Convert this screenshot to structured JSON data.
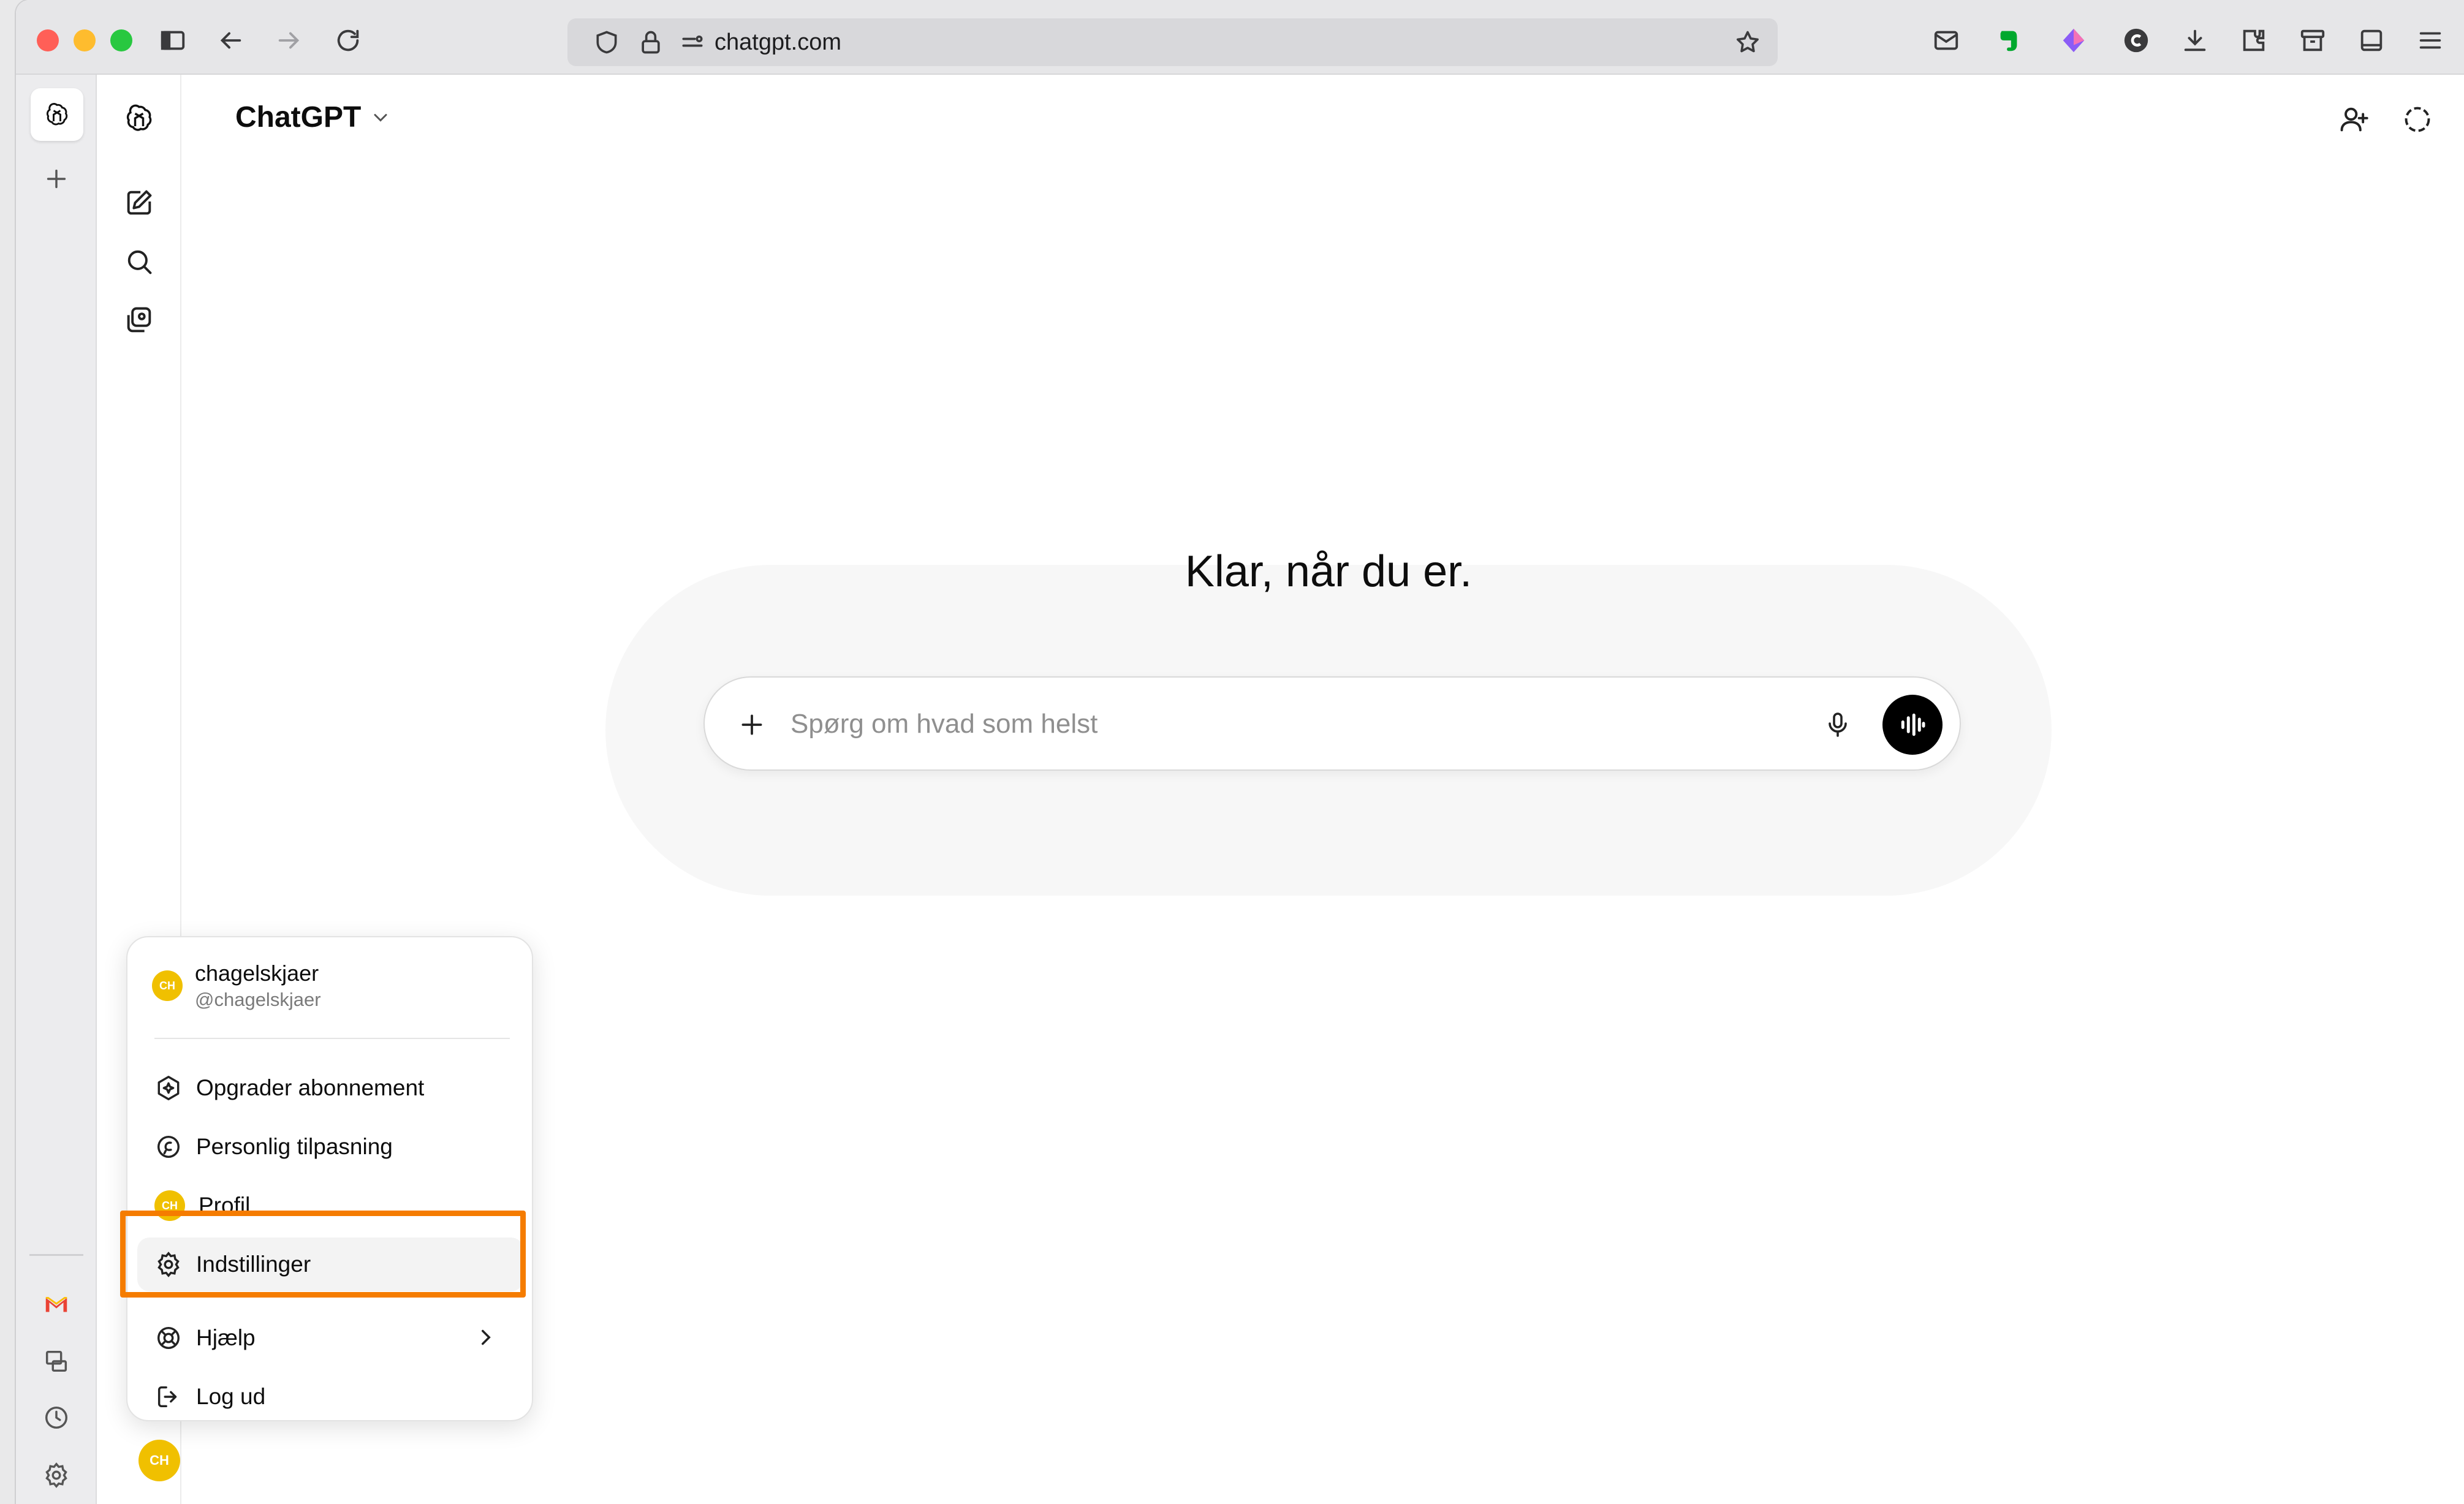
{
  "browser": {
    "url": "chatgpt.com"
  },
  "header": {
    "model_name": "ChatGPT"
  },
  "main": {
    "greeting": "Klar, når du er.",
    "composer_placeholder": "Spørg om hvad som helst"
  },
  "account_menu": {
    "avatar_initials": "CH",
    "username": "chagelskjaer",
    "handle": "@chagelskjaer",
    "items": [
      {
        "label": "Opgrader abonnement",
        "icon": "upgrade-icon"
      },
      {
        "label": "Personlig tilpasning",
        "icon": "personalization-icon"
      },
      {
        "label": "Profil",
        "icon": "avatar"
      },
      {
        "label": "Indstillinger",
        "icon": "gear-icon"
      },
      {
        "label": "Hjælp",
        "icon": "help-icon"
      },
      {
        "label": "Log ud",
        "icon": "logout-icon"
      }
    ]
  },
  "colors": {
    "highlight": "#f57c00",
    "avatar": "#f0c000"
  }
}
